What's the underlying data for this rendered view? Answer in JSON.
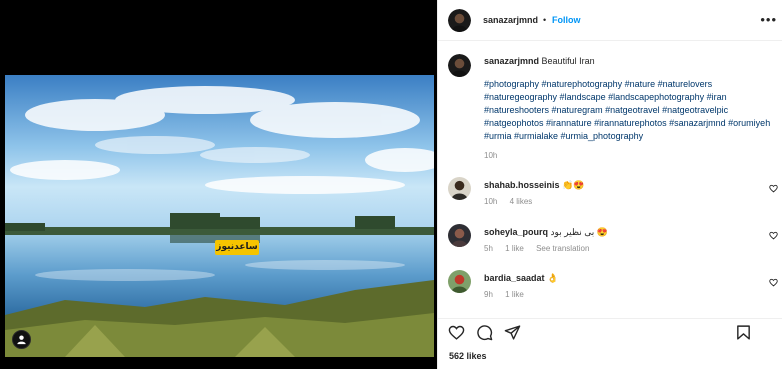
{
  "post": {
    "author": "sanazarjmnd",
    "follow_label": "Follow",
    "separator": "•",
    "more_label": "•••",
    "caption_text": "Beautiful Iran",
    "hashtags": "#photography #naturephotography #nature #naturelovers #naturegeography #landscape #landscapephotography #iran #natureshooters #naturegram #natgeotravel #natgeotravelpic #natgeophotos #irannature #irannaturephotos #sanazarjmnd #orumiyeh #urmia #urmialake #urmia_photography",
    "age": "10h",
    "watermark_text": "ساعدنیوز",
    "likes": "562 likes"
  },
  "comments": [
    {
      "user": "shahab.hosseinis",
      "text": "👏😍",
      "age": "10h",
      "likes": "4 likes",
      "reply": ""
    },
    {
      "user": "soheyla_pourq",
      "text": "بی نظیر بود 😍",
      "age": "5h",
      "likes": "1 like",
      "reply": "See translation"
    },
    {
      "user": "bardia_saadat",
      "text": "👌",
      "age": "9h",
      "likes": "1 like",
      "reply": ""
    }
  ],
  "icons": {
    "like": "heart-icon",
    "comment": "comment-icon",
    "share": "share-icon",
    "save": "bookmark-icon",
    "tag": "user-tag-icon"
  },
  "colors": {
    "link_blue": "#0095f6",
    "hashtag": "#00376b",
    "meta_gray": "#8e8e8e",
    "watermark_bg": "#f6c400"
  }
}
